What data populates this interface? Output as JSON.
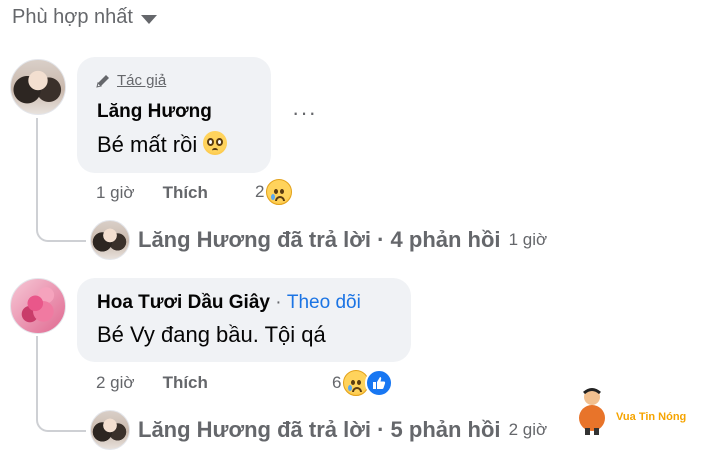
{
  "sort": {
    "label": "Phù hợp nhất"
  },
  "comments": [
    {
      "author_tag": "Tác giả",
      "name": "Lăng Hương",
      "text": "Bé mất rồi",
      "time": "1 giờ",
      "like_label": "Thích",
      "reaction_count": "2",
      "reply": {
        "text": "Lăng Hương đã trả lời · 4 phản hồi",
        "time": "1 giờ"
      }
    },
    {
      "name": "Hoa Tươi Dầu Giây",
      "separator": "·",
      "follow_label": "Theo dõi",
      "text": "Bé Vy đang bầu. Tội qá",
      "time": "2 giờ",
      "like_label": "Thích",
      "reaction_count": "6",
      "reply": {
        "text": "Lăng Hương đã trả lời · 5 phản hồi",
        "time": "2 giờ"
      }
    }
  ],
  "watermark": {
    "text": "Vua Tin Nóng"
  }
}
